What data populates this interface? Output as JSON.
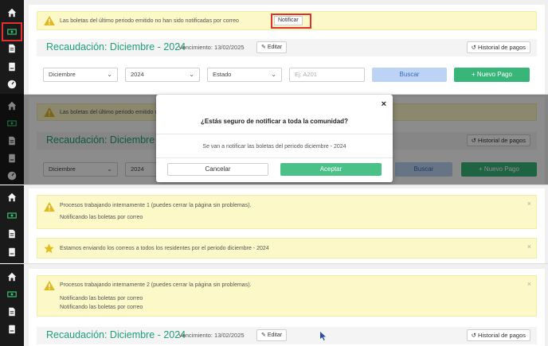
{
  "colors": {
    "accent_green": "#1ea07a",
    "button_green": "#38b67a",
    "button_blue_bg": "#bcd3f5",
    "alert_bg": "#fdf8c8",
    "sidebar_bg": "#1a1a1a",
    "highlight_red": "#e03030"
  },
  "sidebar": {
    "icons": [
      "home-icon",
      "money-icon",
      "document-icon",
      "receipt-icon",
      "gauge-icon"
    ]
  },
  "frame1": {
    "alert_text": "Las boletas del último periodo emitido no han sido notificadas por correo",
    "notify_label": "Notificar",
    "title": "Recaudación: Diciembre - 2024",
    "vencimiento": "Vencimiento: 13/02/2025",
    "edit_label": "Editar",
    "history_label": "Historial de pagos",
    "filters": {
      "month": "Diciembre",
      "year": "2024",
      "state": "Estado",
      "search_placeholder": "Ej: A201",
      "search_label": "Buscar",
      "new_label": "+ Nuevo Pago"
    }
  },
  "frame2": {
    "alert_text": "Las boletas del último periodo emitido n",
    "title": "Recaudación: Diciembre - 2",
    "history_label": "Historial de pagos",
    "month": "Diciembre",
    "year": "2024",
    "search_label": "Buscar",
    "new_label": "+ Nuevo Pago",
    "modal": {
      "question": "¿Estás seguro de notificar a toda la comunidad?",
      "message": "Se van a notificar las boletas del periodo diciembre - 2024",
      "cancel_label": "Cancelar",
      "accept_label": "Aceptar"
    }
  },
  "frame3": {
    "alert1_title": "Procesos trabajando internamente 1 (puedes cerrar la página sin problemas).",
    "alert1_line": "Notificando las boletas por correo",
    "alert2_text": "Estamos enviando los correos a todos los residentes por el periodo diciembre - 2024"
  },
  "frame4": {
    "alert_title": "Procesos trabajando internamente 2 (puedes cerrar la página sin problemas).",
    "alert_line1": "Notificando las boletas por correo",
    "alert_line2": "Notificando las boletas por correo",
    "title": "Recaudación: Diciembre - 2024",
    "vencimiento": "Vencimiento: 13/02/2025",
    "edit_label": "Editar",
    "history_label": "Historial de pagos"
  },
  "close_glyph": "×"
}
